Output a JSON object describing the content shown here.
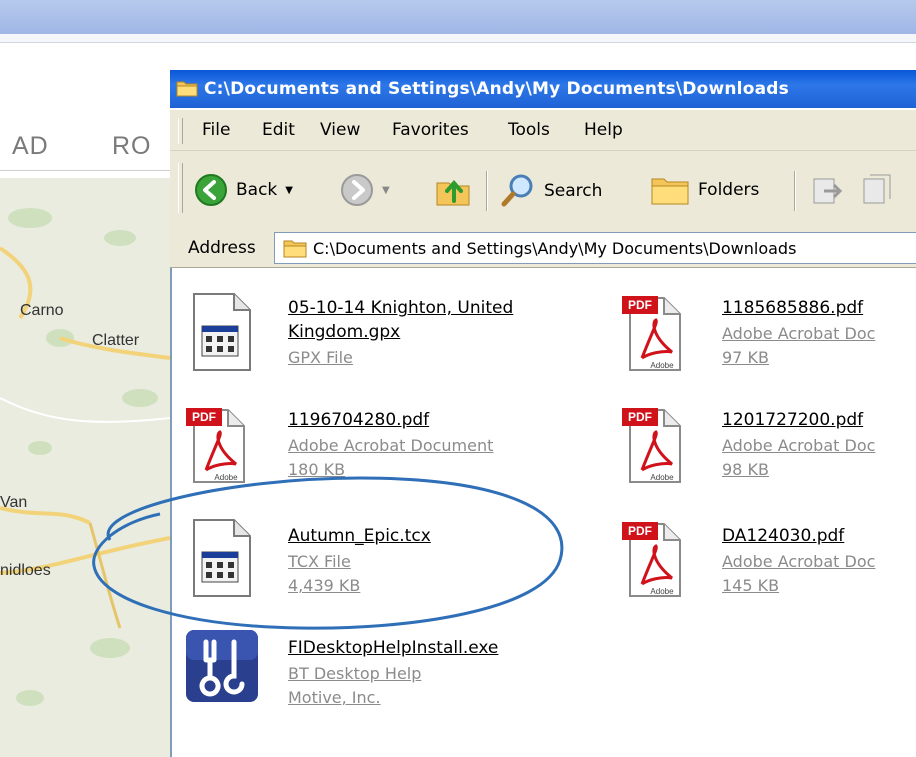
{
  "window": {
    "title": "C:\\Documents and Settings\\Andy\\My Documents\\Downloads"
  },
  "background": {
    "nav_items": [
      "AD",
      "RO"
    ],
    "map_labels": [
      "Carno",
      "Clatter",
      "Van",
      "nidloes"
    ]
  },
  "menu": {
    "items": [
      "File",
      "Edit",
      "View",
      "Favorites",
      "Tools",
      "Help"
    ]
  },
  "toolbar": {
    "back": "Back",
    "search": "Search",
    "folders": "Folders"
  },
  "address": {
    "label": "Address",
    "value": "C:\\Documents and Settings\\Andy\\My Documents\\Downloads"
  },
  "files": [
    {
      "name_line1": "05-10-14 Knighton, United",
      "name_line2": "Kingdom.gpx",
      "type": "GPX File",
      "icon": "generic-file-icon"
    },
    {
      "name_line1": "1185685886.pdf",
      "type": "Adobe Acrobat Doc",
      "size": "97 KB",
      "icon": "pdf-icon"
    },
    {
      "name_line1": "1196704280.pdf",
      "type": "Adobe Acrobat Document",
      "size": "180 KB",
      "icon": "pdf-icon"
    },
    {
      "name_line1": "1201727200.pdf",
      "type": "Adobe Acrobat Doc",
      "size": "98 KB",
      "icon": "pdf-icon"
    },
    {
      "name_line1": "Autumn_Epic.tcx",
      "type": "TCX File",
      "size": "4,439 KB",
      "icon": "generic-file-icon"
    },
    {
      "name_line1": "DA124030.pdf",
      "type": "Adobe Acrobat Doc",
      "size": "145 KB",
      "icon": "pdf-icon"
    },
    {
      "name_line1": "FIDesktopHelpInstall.exe",
      "type": "BT Desktop Help",
      "size": "Motive, Inc.",
      "icon": "tools-app-icon"
    }
  ],
  "icons": {
    "pdf_badge": "PDF",
    "adobe_label": "Adobe"
  },
  "colors": {
    "titlebar": "#0a58d8",
    "highlight_ellipse": "#2f6fb7",
    "pdf_red": "#d0121b"
  }
}
